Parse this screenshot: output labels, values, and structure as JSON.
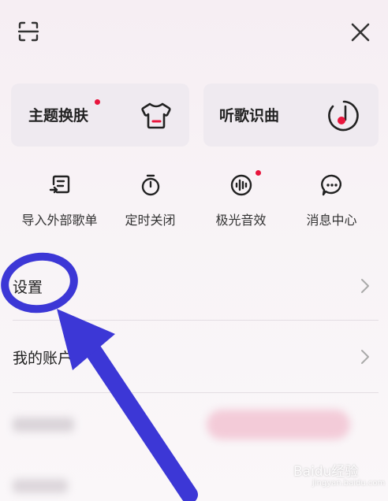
{
  "header": {
    "scan_icon": "scan-icon",
    "close_icon": "close-icon"
  },
  "cards": [
    {
      "label": "主题换肤",
      "icon": "tshirt-icon",
      "badge": true
    },
    {
      "label": "听歌识曲",
      "icon": "music-note-recognize-icon",
      "badge": false
    }
  ],
  "quick_actions": [
    {
      "label": "导入外部歌单",
      "icon": "import-playlist-icon",
      "badge": false
    },
    {
      "label": "定时关闭",
      "icon": "timer-icon",
      "badge": false
    },
    {
      "label": "极光音效",
      "icon": "sound-effect-icon",
      "badge": true
    },
    {
      "label": "消息中心",
      "icon": "message-icon",
      "badge": false
    }
  ],
  "menu": [
    {
      "label": "设置"
    },
    {
      "label": "我的账户"
    }
  ],
  "watermark": {
    "text": "Baidu经验",
    "sub": "jingyan.baidu.com"
  },
  "colors": {
    "accent": "#e8143c",
    "annotation": "#3c37d6"
  }
}
